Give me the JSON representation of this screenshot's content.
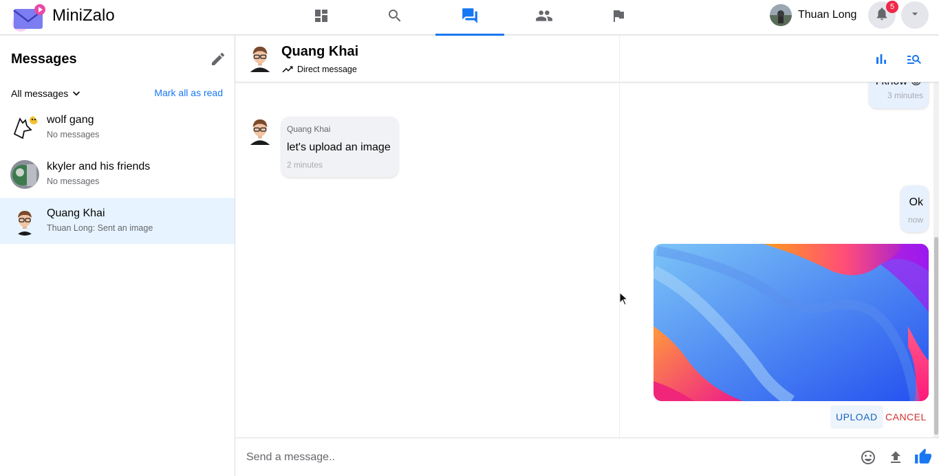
{
  "app": {
    "name": "MiniZalo"
  },
  "nav": {
    "tabs": [
      {
        "name": "dashboard-icon",
        "active": false
      },
      {
        "name": "search-icon",
        "active": false
      },
      {
        "name": "messages-icon",
        "active": true
      },
      {
        "name": "friends-icon",
        "active": false
      },
      {
        "name": "flag-icon",
        "active": false
      }
    ],
    "accent": "#1877f2"
  },
  "user": {
    "name": "Thuan Long",
    "notifications": "5"
  },
  "sidebar": {
    "title": "Messages",
    "filter": "All messages",
    "mark_all": "Mark all as read",
    "conversations": [
      {
        "name": "wolf gang",
        "last": "No messages",
        "active": false
      },
      {
        "name": "kkyler and his friends",
        "last": "No messages",
        "active": false
      },
      {
        "name": "Quang Khai",
        "last": "Thuan Long: Sent an image",
        "active": true
      }
    ]
  },
  "chat": {
    "name": "Quang Khai",
    "subtitle": "Direct message",
    "messages": [
      {
        "mine": true,
        "text": "I know 😊",
        "time": "3 minutes"
      },
      {
        "mine": false,
        "sender": "Quang Khai",
        "text": "let's upload an image",
        "time": "2 minutes"
      },
      {
        "mine": true,
        "text": "Ok",
        "time": "now"
      }
    ],
    "upload_label": "UPLOAD",
    "cancel_label": "CANCEL"
  },
  "composer": {
    "placeholder": "Send a message.."
  }
}
